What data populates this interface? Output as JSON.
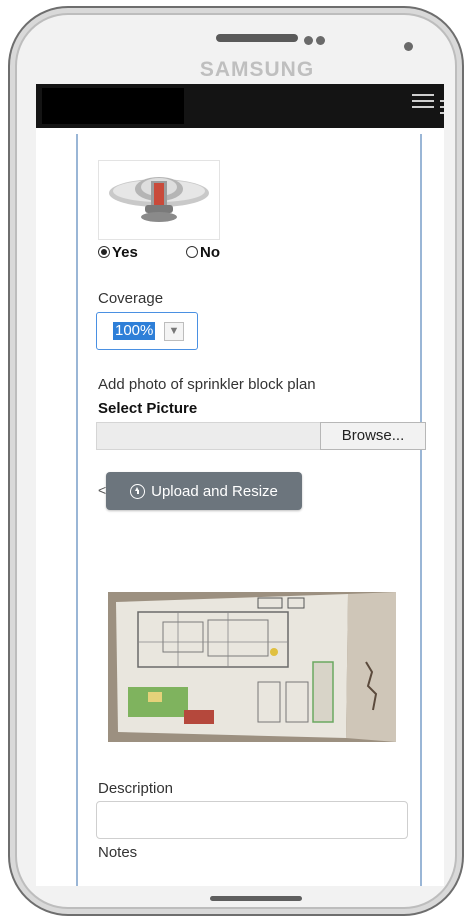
{
  "device": {
    "brand": "SAMSUNG"
  },
  "form": {
    "radio_yes": "Yes",
    "radio_no": "No",
    "selected_option": "yes",
    "coverage_label": "Coverage",
    "coverage_value": "100%",
    "photo_prompt": "Add photo of sprinkler block plan",
    "select_picture_label": "Select Picture",
    "browse_label": "Browse...",
    "lt_symbol": "<",
    "upload_label": "Upload and Resize",
    "description_label": "Description",
    "notes_label": "Notes"
  },
  "icons": {
    "menu": "hamburger-icon",
    "upload": "circle-arrow-up-icon",
    "dropdown": "chevron-down-icon"
  },
  "colors": {
    "accent": "#2e7fd8",
    "upload_button": "#6c757d",
    "content_border": "#9ab6d6",
    "topbar": "#141414"
  }
}
